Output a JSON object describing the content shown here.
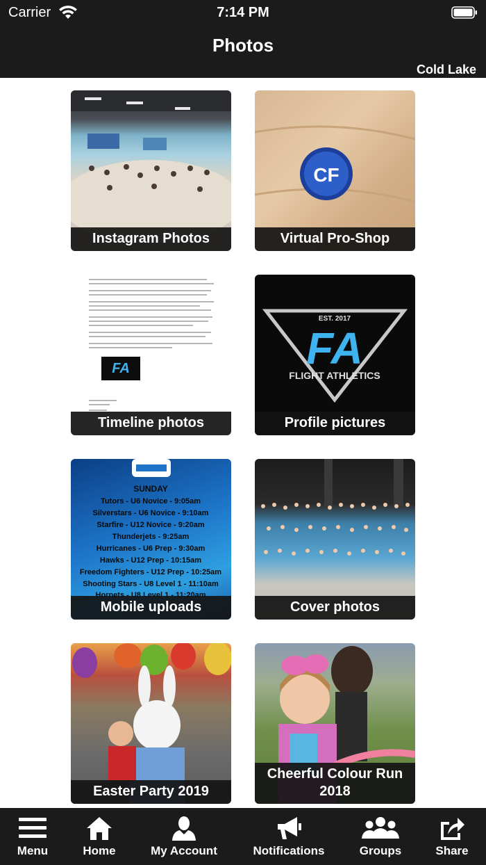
{
  "status_bar": {
    "carrier": "Carrier",
    "time": "7:14 PM"
  },
  "header": {
    "title": "Photos",
    "location": "Cold Lake"
  },
  "albums": [
    {
      "caption": "Instagram Photos"
    },
    {
      "caption": "Virtual Pro-Shop"
    },
    {
      "caption": "Timeline photos"
    },
    {
      "caption": "Profile pictures"
    },
    {
      "caption": "Mobile uploads"
    },
    {
      "caption": "Cover photos"
    },
    {
      "caption": "Easter Party 2019"
    },
    {
      "caption": "Cheerful Colour Run 2018"
    }
  ],
  "album_images": {
    "profile_logo": {
      "est": "EST. 2017",
      "letters": "FA",
      "brand": "FLIGHT ATHLETICS"
    },
    "proshop_badge": "CF",
    "schedule": {
      "heading": "SUNDAY",
      "lines": [
        "Tutors - U6 Novice - 9:05am",
        "Silverstars - U6 Novice - 9:10am",
        "Starfire - U12 Novice - 9:20am",
        "Thunderjets - 9:25am",
        "Hurricanes - U6 Prep - 9:30am",
        "Hawks - U12 Prep - 10:15am",
        "Freedom Fighters - U12 Prep - 10:25am",
        "Shooting Stars - U8 Level 1 - 11:10am",
        "Hornets - U8 Level 1 - 11:20am"
      ]
    }
  },
  "tabbar": [
    {
      "label": "Menu",
      "icon": "menu-icon"
    },
    {
      "label": "Home",
      "icon": "home-icon"
    },
    {
      "label": "My Account",
      "icon": "account-icon"
    },
    {
      "label": "Notifications",
      "icon": "megaphone-icon"
    },
    {
      "label": "Groups",
      "icon": "groups-icon"
    },
    {
      "label": "Share",
      "icon": "share-icon"
    }
  ]
}
